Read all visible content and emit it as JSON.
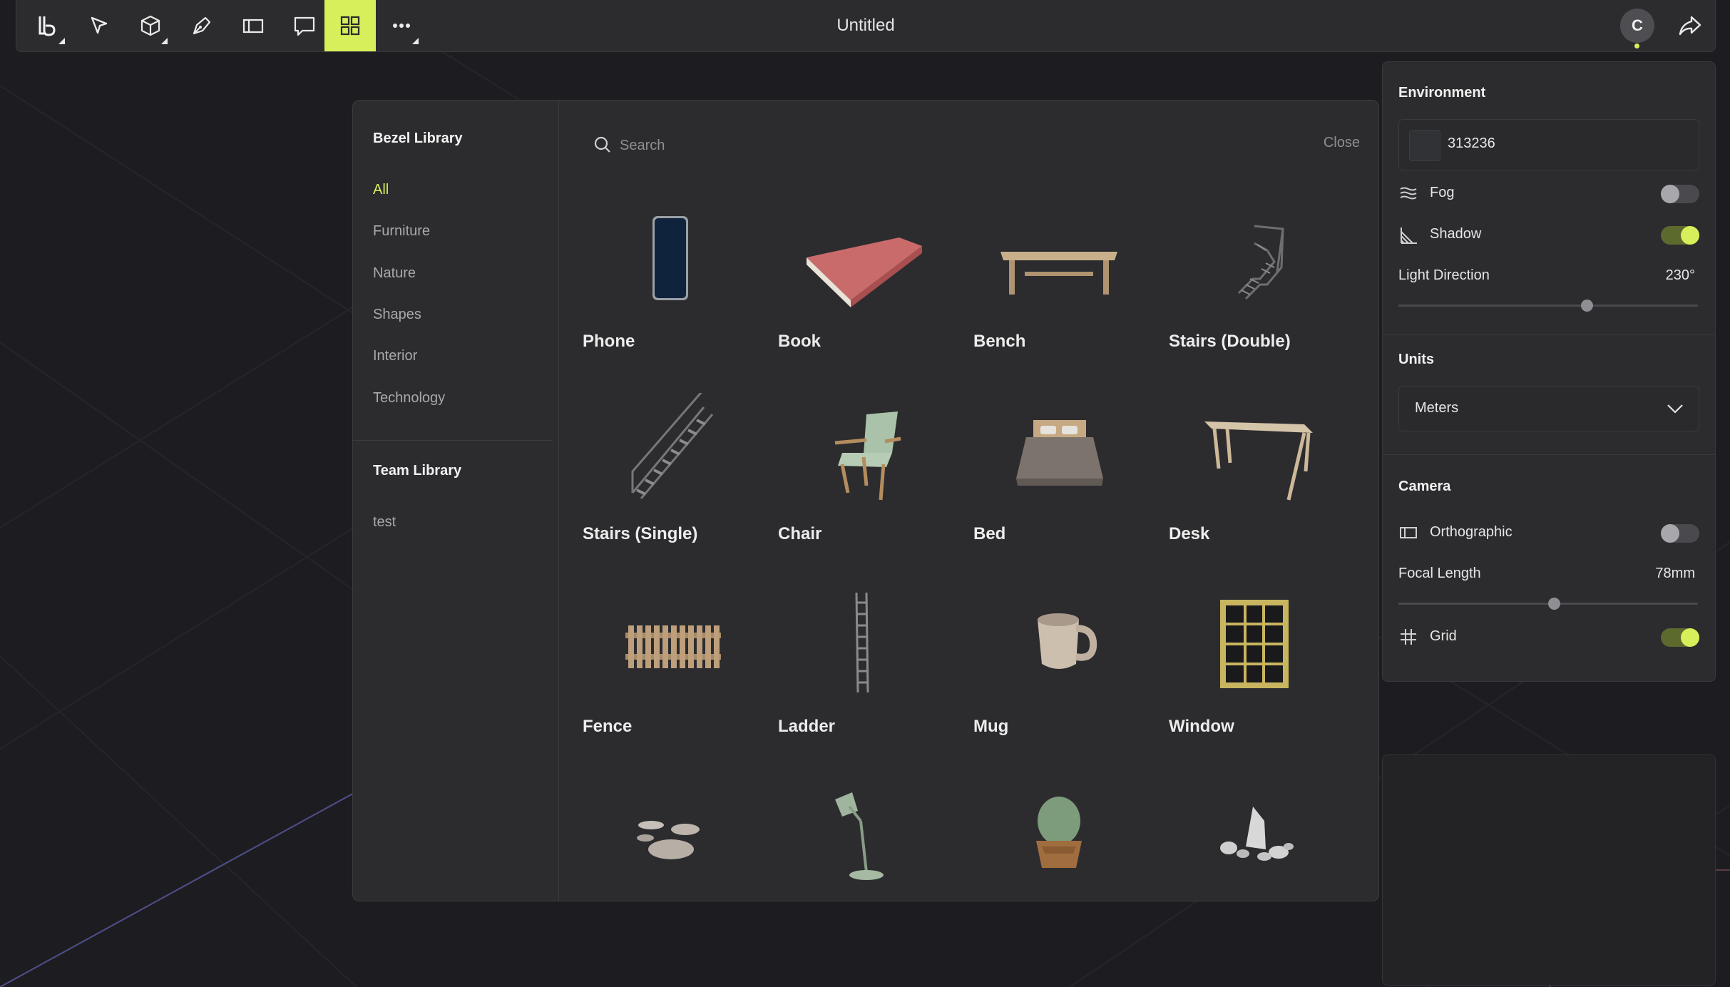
{
  "document": {
    "title": "Untitled"
  },
  "user": {
    "initial": "C"
  },
  "colors": {
    "accent": "#d6ef5a",
    "panel": "#2c2c2f",
    "canvas": "#1d1d21"
  },
  "toolbar": {
    "tools": [
      "logo-menu",
      "select",
      "primitives",
      "pen",
      "frame",
      "comment",
      "library",
      "more"
    ],
    "active_tool": "library"
  },
  "library": {
    "title": "Bezel Library",
    "categories": [
      "All",
      "Furniture",
      "Nature",
      "Shapes",
      "Interior",
      "Technology"
    ],
    "active_category": "All",
    "team_title": "Team Library",
    "team_items": [
      "test"
    ],
    "search": {
      "placeholder": "Search",
      "value": ""
    },
    "close_label": "Close",
    "items": [
      {
        "label": "Phone",
        "icon": "phone-model"
      },
      {
        "label": "Book",
        "icon": "book-model"
      },
      {
        "label": "Bench",
        "icon": "bench-model"
      },
      {
        "label": "Stairs (Double)",
        "icon": "stairs-double-model"
      },
      {
        "label": "Stairs (Single)",
        "icon": "stairs-single-model"
      },
      {
        "label": "Chair",
        "icon": "chair-model"
      },
      {
        "label": "Bed",
        "icon": "bed-model"
      },
      {
        "label": "Desk",
        "icon": "desk-model"
      },
      {
        "label": "Fence",
        "icon": "fence-model"
      },
      {
        "label": "Ladder",
        "icon": "ladder-model"
      },
      {
        "label": "Mug",
        "icon": "mug-model"
      },
      {
        "label": "Window",
        "icon": "window-model"
      },
      {
        "label": "",
        "icon": "stepping-stones-model"
      },
      {
        "label": "",
        "icon": "lamp-model"
      },
      {
        "label": "",
        "icon": "cactus-model"
      },
      {
        "label": "",
        "icon": "rocks-model"
      }
    ]
  },
  "panel": {
    "environment": {
      "title": "Environment",
      "color_value": "313236",
      "fog_label": "Fog",
      "fog_on": false,
      "shadow_label": "Shadow",
      "shadow_on": true,
      "light_direction_label": "Light Direction",
      "light_direction_value": "230°",
      "light_direction_fraction": 0.63
    },
    "units": {
      "title": "Units",
      "selected": "Meters"
    },
    "camera": {
      "title": "Camera",
      "orthographic_label": "Orthographic",
      "orthographic_on": false,
      "focal_length_label": "Focal Length",
      "focal_length_value": "78mm",
      "focal_length_fraction": 0.52,
      "grid_label": "Grid",
      "grid_on": true
    }
  }
}
